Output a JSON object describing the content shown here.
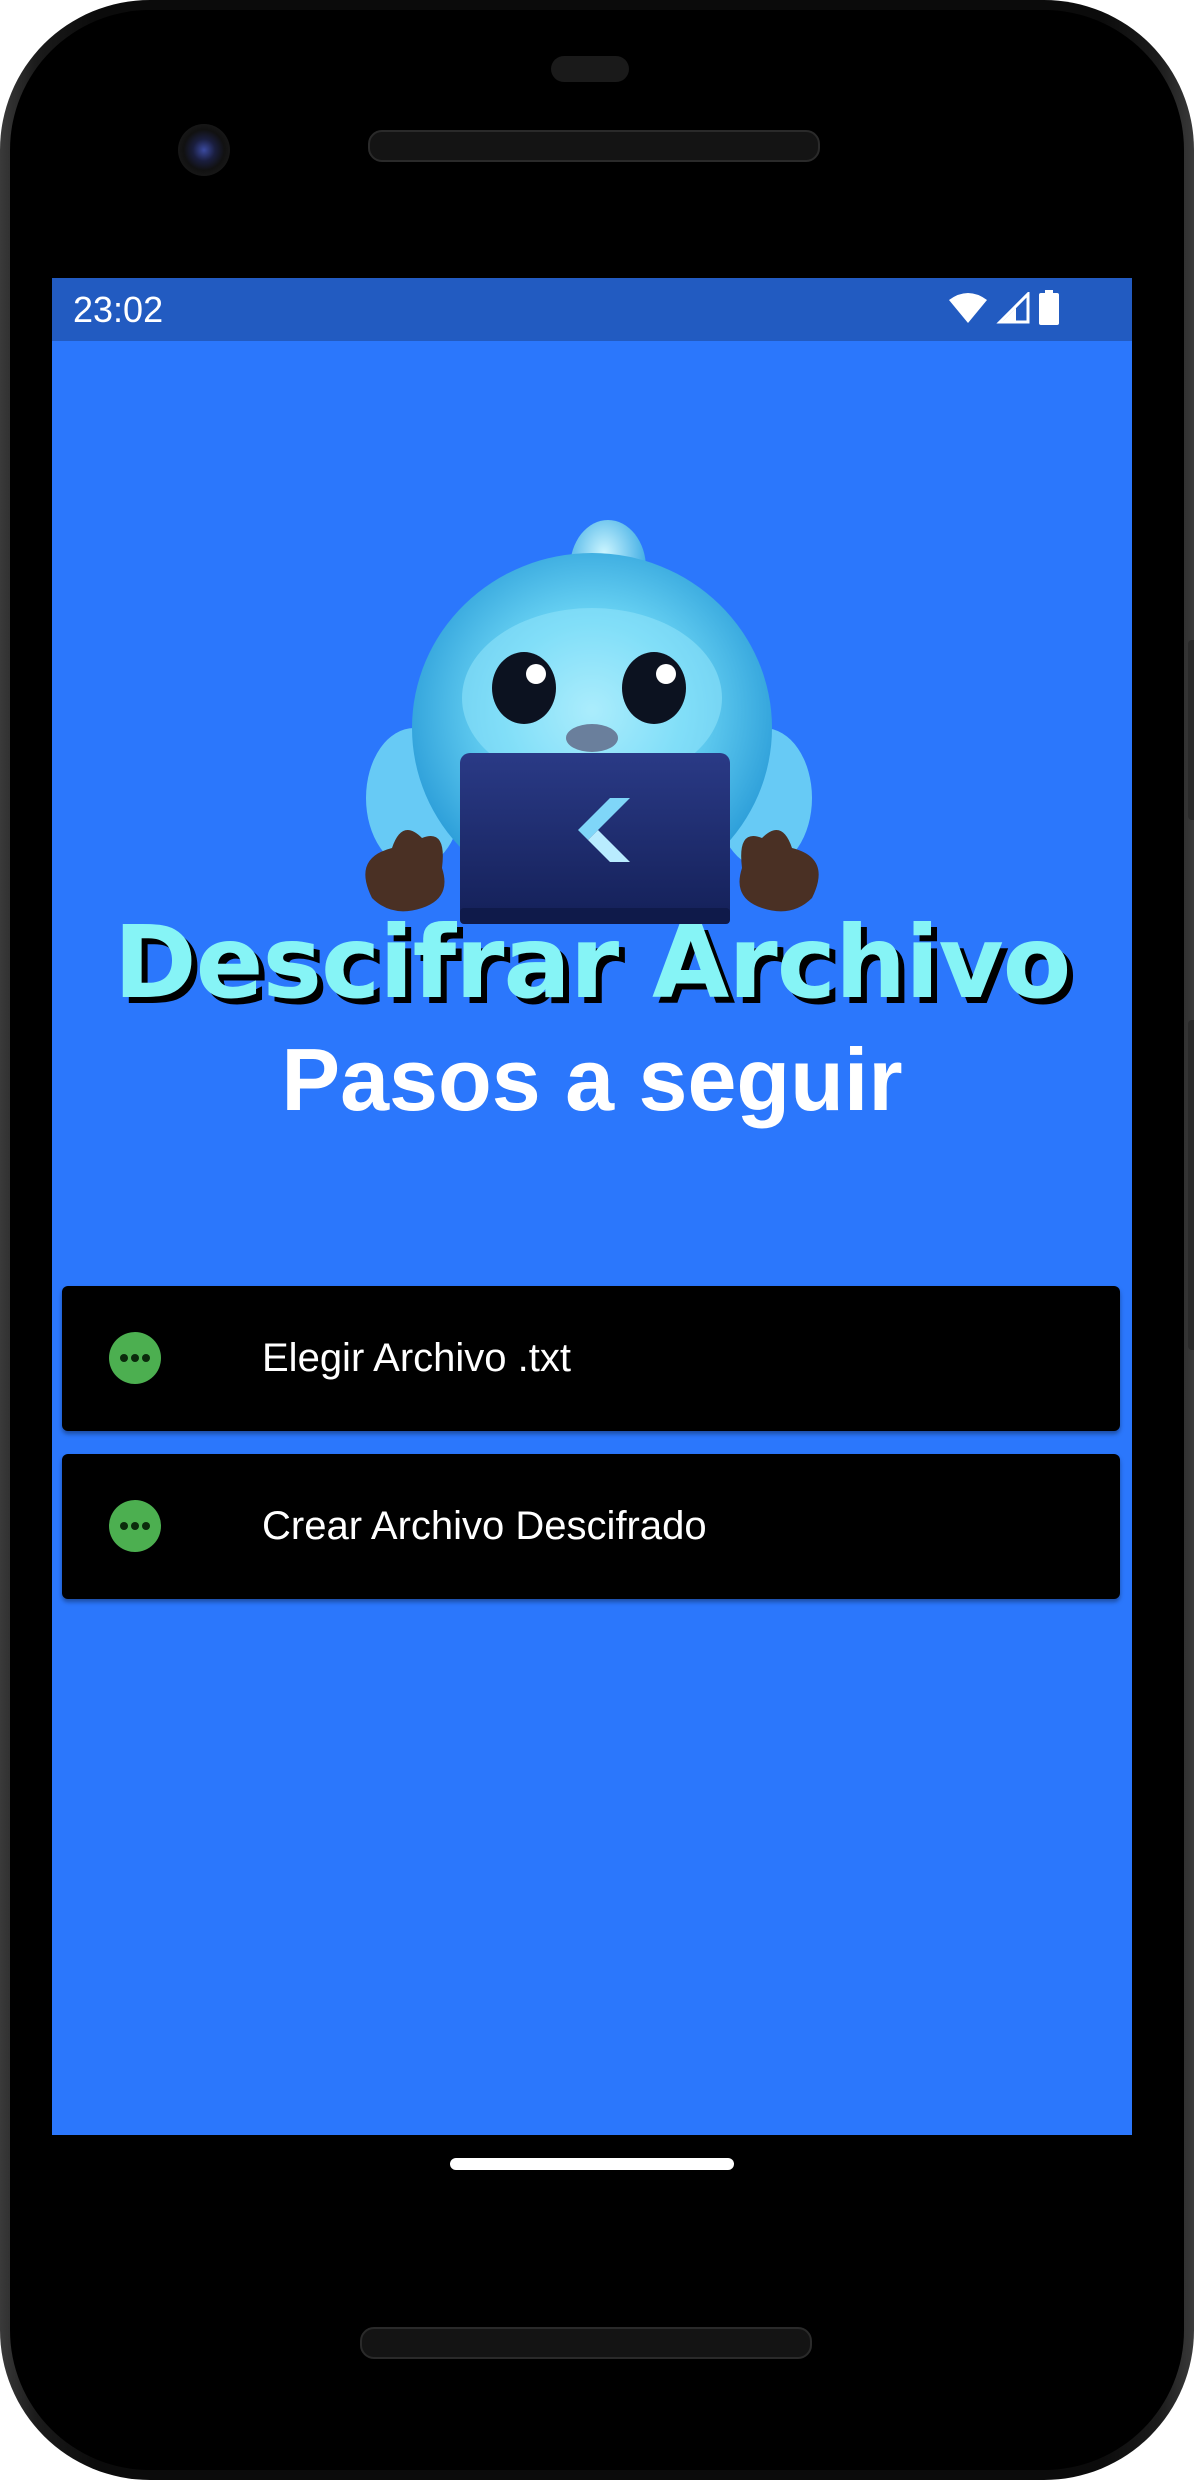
{
  "status_bar": {
    "time": "23:02",
    "icons": [
      "wifi-icon",
      "cell-signal-icon",
      "battery-icon"
    ]
  },
  "header": {
    "title": "Descifrar Archivo",
    "subtitle": "Pasos a seguir"
  },
  "mascot": {
    "icon": "dash-mascot-with-laptop"
  },
  "steps": [
    {
      "label": "Elegir Archivo .txt",
      "icon": "more-horizontal-icon"
    },
    {
      "label": "Crear Archivo Descifrado",
      "icon": "more-horizontal-icon"
    }
  ],
  "colors": {
    "background": "#2b77fc",
    "status_bar": "#225bc1",
    "title": "#86f4f6",
    "step_card": "#000000",
    "step_icon": "#4caf50"
  }
}
